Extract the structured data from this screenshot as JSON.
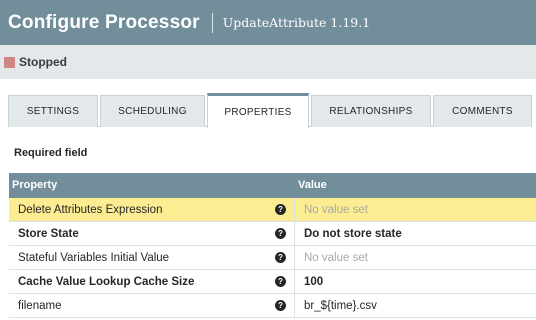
{
  "header": {
    "title": "Configure Processor",
    "subtitle": "UpdateAttribute 1.19.1"
  },
  "status": {
    "label": "Stopped",
    "color": "#d18686"
  },
  "tabs": [
    {
      "label": "SETTINGS",
      "active": false
    },
    {
      "label": "SCHEDULING",
      "active": false
    },
    {
      "label": "PROPERTIES",
      "active": true
    },
    {
      "label": "RELATIONSHIPS",
      "active": false
    },
    {
      "label": "COMMENTS",
      "active": false
    }
  ],
  "required_field_label": "Required field",
  "table": {
    "columns": [
      "Property",
      "Value"
    ],
    "rows": [
      {
        "name": "Delete Attributes Expression",
        "value": "No value set",
        "help_glyph": "?"
      },
      {
        "name": "Store State",
        "value": "Do not store state",
        "help_glyph": "?"
      },
      {
        "name": "Stateful Variables Initial Value",
        "value": "No value set",
        "help_glyph": "?"
      },
      {
        "name": "Cache Value Lookup Cache Size",
        "value": "100",
        "help_glyph": "?"
      },
      {
        "name": "filename",
        "value": "br_${time}.csv",
        "help_glyph": "?"
      }
    ]
  },
  "colors": {
    "header_bg": "#728e9b",
    "selected_row_bg": "#fcec92",
    "status_bar_bg": "#e3e8eb"
  }
}
